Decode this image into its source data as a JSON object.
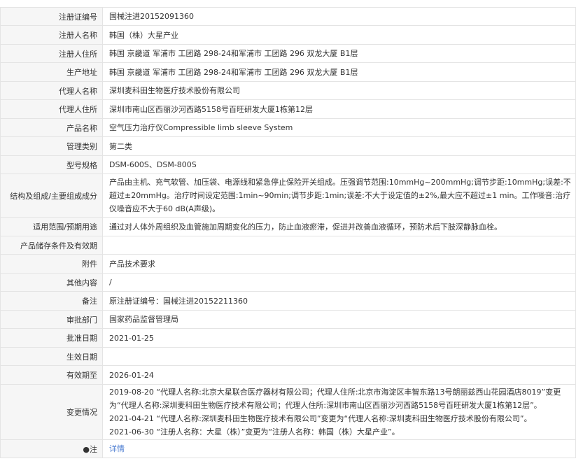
{
  "rows": [
    {
      "label": "注册证编号",
      "value": "国械注进20152091360"
    },
    {
      "label": "注册人名称",
      "value": "韩国（株）大星产业"
    },
    {
      "label": "注册人住所",
      "value": "韩国 京畿道 军浦市 工团路 298-24和军浦市 工团路 296 双龙大厦 B1层"
    },
    {
      "label": "生产地址",
      "value": "韩国 京畿道 军浦市 工团路 298-24和军浦市 工团路 296 双龙大厦 B1层"
    },
    {
      "label": "代理人名称",
      "value": "深圳麦科田生物医疗技术股份有限公司"
    },
    {
      "label": "代理人住所",
      "value": "深圳市南山区西丽沙河西路5158号百旺研发大厦1栋第12层"
    },
    {
      "label": "产品名称",
      "value": "空气压力治疗仪Compressible limb sleeve System"
    },
    {
      "label": "管理类别",
      "value": "第二类"
    },
    {
      "label": "型号规格",
      "value": "DSM-600S、DSM-800S"
    },
    {
      "label": "结构及组成/主要组成成分",
      "value": "产品由主机、充气软管、加压袋、电源线和紧急停止保险开关组成。压强调节范围:10mmHg~200mmHg;调节步距:10mmHg;误差:不超过±20mmHg。治疗时间设定范围:1min~90min;调节步距:1min;误差:不大于设定值的±2%,最大应不超过±1 min。工作噪音:治疗仪噪音应不大于60 dB(A声级)。"
    },
    {
      "label": "适用范围/预期用途",
      "value": "通过对人体外周组织及血管施加周期变化的压力，防止血液瘀滞，促进并改善血液循环，预防术后下肢深静脉血栓。"
    },
    {
      "label": "产品储存条件及有效期",
      "value": ""
    },
    {
      "label": "附件",
      "value": "产品技术要求"
    },
    {
      "label": "其他内容",
      "value": "/"
    },
    {
      "label": "备注",
      "value": "原注册证编号：国械注进20152211360"
    },
    {
      "label": "审批部门",
      "value": "国家药品监督管理局"
    },
    {
      "label": "批准日期",
      "value": "2021-01-25"
    },
    {
      "label": "生效日期",
      "value": ""
    },
    {
      "label": "有效期至",
      "value": "2026-01-24"
    },
    {
      "label": "变更情况",
      "value": "2019-08-20 “代理人名称:北京大星联合医疗器材有限公司；代理人住所:北京市海淀区丰智东路13号朗丽兹西山花园酒店8019”变更为“代理人名称:深圳麦科田生物医疗技术有限公司；代理人住所:深圳市南山区西丽沙河西路5158号百旺研发大厦1栋第12层”。\n2021-04-21 “代理人名称:深圳麦科田生物医疗技术有限公司”变更为“代理人名称:深圳麦科田生物医疗技术股份有限公司”。\n2021-06-30 “注册人名称：大星（株）”变更为“注册人名称：韩国（株）大星产业”。"
    }
  ],
  "note_row": {
    "icon": "info-icon",
    "label_icon_glyph": "●",
    "label": "注",
    "link_text": "详情",
    "link_color": "#4a7bd0"
  }
}
